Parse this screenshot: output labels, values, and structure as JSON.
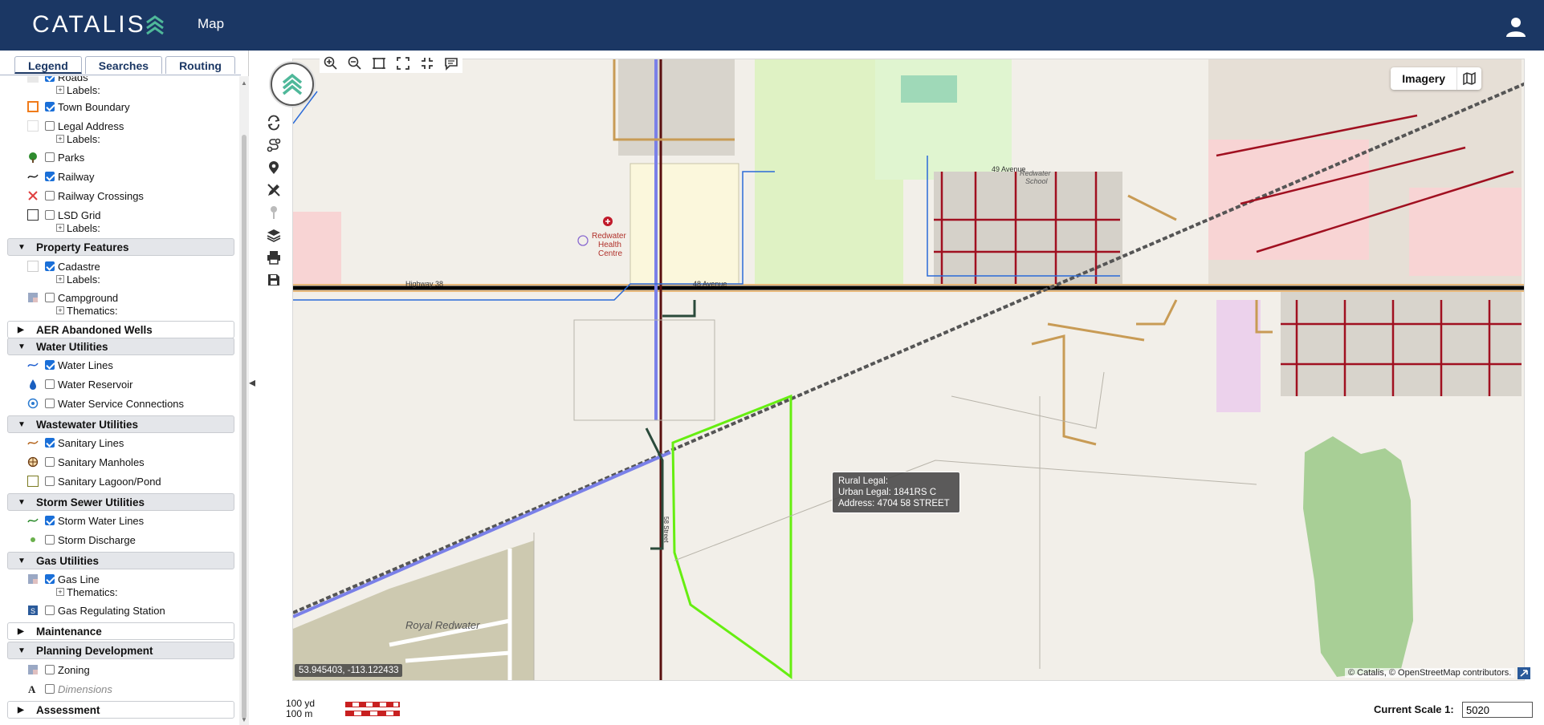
{
  "header": {
    "brand": "CATALIS",
    "title": "Map"
  },
  "tabs": [
    {
      "label": "Legend",
      "active": true
    },
    {
      "label": "Searches",
      "active": false
    },
    {
      "label": "Routing",
      "active": false
    }
  ],
  "legend": {
    "roads_label": "Roads",
    "labels_text": "Labels:",
    "thematics_text": "Thematics:",
    "items": {
      "town_boundary": "Town Boundary",
      "legal_address": "Legal Address",
      "parks": "Parks",
      "railway": "Railway",
      "railway_crossings": "Railway Crossings",
      "lsd_grid": "LSD Grid",
      "cadastre": "Cadastre",
      "campground": "Campground",
      "water_lines": "Water Lines",
      "water_reservoir": "Water Reservoir",
      "water_service": "Water Service Connections",
      "sanitary_lines": "Sanitary Lines",
      "sanitary_manholes": "Sanitary Manholes",
      "sanitary_lagoon": "Sanitary Lagoon/Pond",
      "storm_water_lines": "Storm Water Lines",
      "storm_discharge": "Storm Discharge",
      "gas_line": "Gas Line",
      "gas_regulating": "Gas Regulating Station",
      "zoning": "Zoning",
      "dimensions": "Dimensions"
    },
    "groups": {
      "property_features": "Property Features",
      "aer_wells": "AER Abandoned Wells",
      "water_utilities": "Water Utilities",
      "wastewater_utilities": "Wastewater Utilities",
      "storm_sewer": "Storm Sewer Utilities",
      "gas_utilities": "Gas Utilities",
      "maintenance": "Maintenance",
      "planning": "Planning Development",
      "assessment": "Assessment"
    }
  },
  "map": {
    "basemap_label": "Imagery",
    "popup": {
      "rural_legal": "Rural Legal:",
      "urban_legal": "Urban Legal: 1841RS C",
      "address": "Address: 4704 58 STREET"
    },
    "coordinates": "53.945403, -113.122433",
    "attribution": "© Catalis, © OpenStreetMap contributors.",
    "place_labels": {
      "health_centre": [
        "Redwater",
        "Health",
        "Centre"
      ],
      "royal_redwater": "Royal Redwater",
      "highway": "Highway 38",
      "avenue_48": "48 Avenue",
      "avenue_49": "49 Avenue",
      "school": [
        "Redwater",
        "School"
      ],
      "street_58": "58 Street"
    }
  },
  "footer": {
    "scale_yd": "100 yd",
    "scale_m": "100 m",
    "scale_label": "Current Scale 1:",
    "scale_value": "5020"
  }
}
